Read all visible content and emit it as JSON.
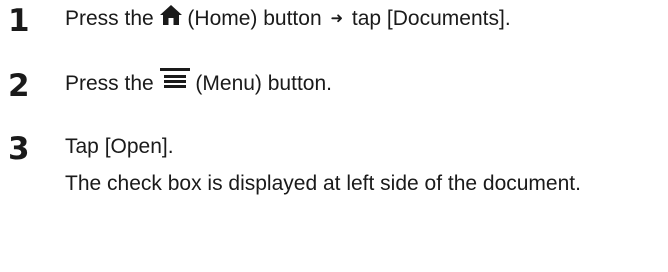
{
  "steps": [
    {
      "number": "1",
      "before_icon": "Press the",
      "icon": "home-icon",
      "after_icon": "(Home) button",
      "arrow": "➜",
      "after_arrow": "tap [Documents]."
    },
    {
      "number": "2",
      "before_icon": "Press the",
      "icon": "menu-icon",
      "after_icon": "(Menu) button."
    },
    {
      "number": "3",
      "text": "Tap [Open].",
      "description": "The check box is displayed at left side of the document."
    }
  ]
}
